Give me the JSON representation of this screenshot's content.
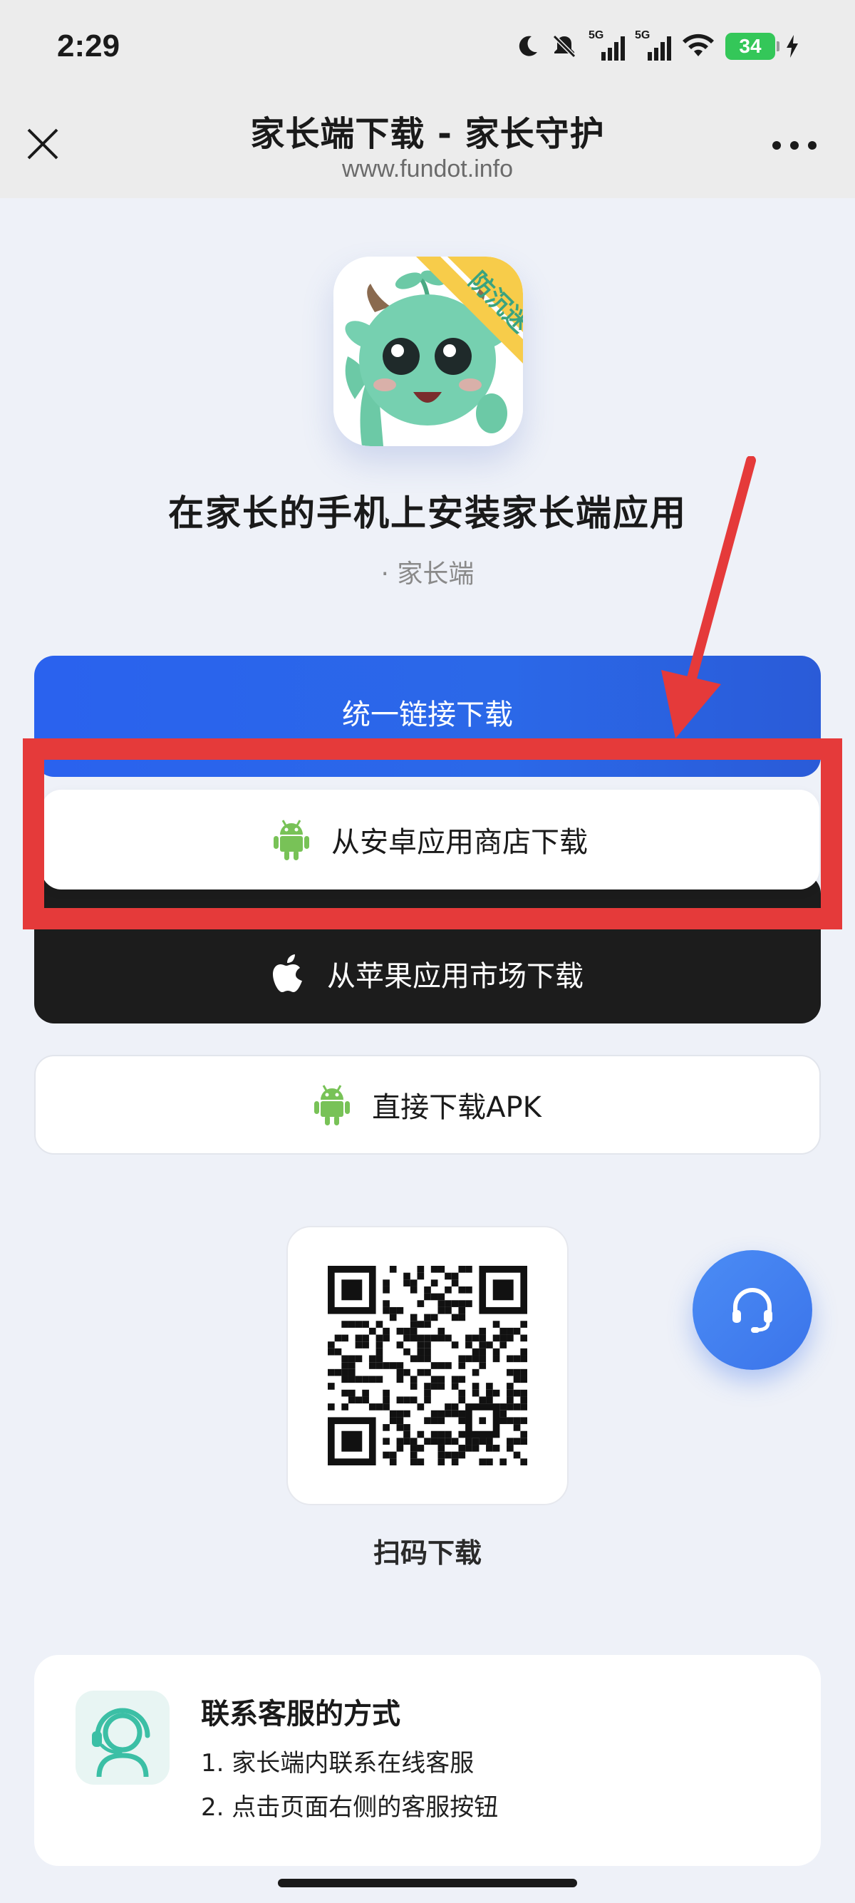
{
  "status_bar": {
    "time": "2:29",
    "network_1": "5G",
    "network_2": "5G",
    "battery": "34"
  },
  "header": {
    "title": "家长端下载 - 家长守护",
    "url": "www.fundot.info"
  },
  "app": {
    "badge_text": "防沉迷",
    "title": "在家长的手机上安装家长端应用",
    "subtitle": "· 家长端"
  },
  "buttons": {
    "unified": "统一链接下载",
    "android_store": "从安卓应用商店下载",
    "apple_store": "从苹果应用市场下载",
    "apk": "直接下载APK"
  },
  "qr": {
    "label": "扫码下载"
  },
  "contact": {
    "title": "联系客服的方式",
    "line1": "1. 家长端内联系在线客服",
    "line2": "2. 点击页面右侧的客服按钮"
  },
  "colors": {
    "primary_blue": "#2a62ee",
    "apple_black": "#1c1c1c",
    "android_green": "#78c257",
    "annotation_red": "#e53a3a"
  }
}
